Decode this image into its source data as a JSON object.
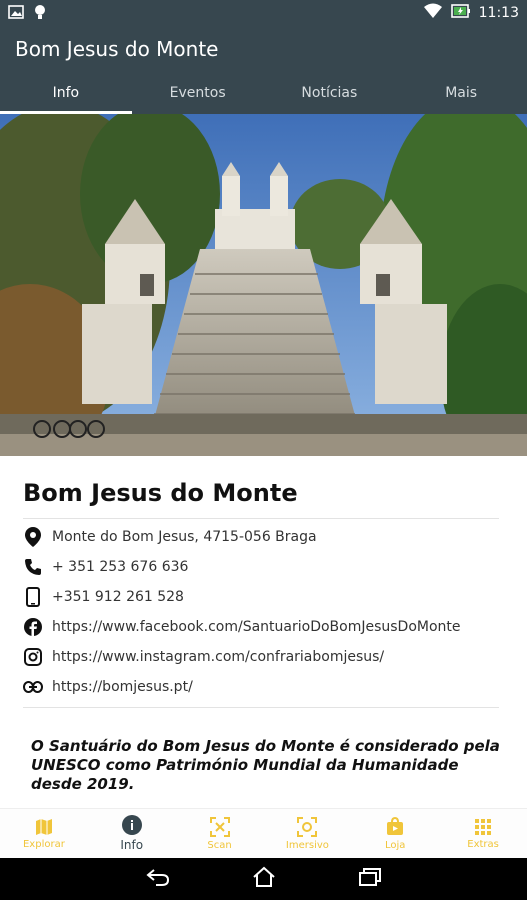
{
  "status_bar": {
    "time": "11:13",
    "icons": [
      "image-icon",
      "bulb-icon",
      "wifi-icon",
      "battery-charging-icon"
    ]
  },
  "app_bar": {
    "title": "Bom Jesus do Monte"
  },
  "tabs": [
    {
      "label": "Info",
      "active": true
    },
    {
      "label": "Eventos",
      "active": false
    },
    {
      "label": "Notícias",
      "active": false
    },
    {
      "label": "Mais",
      "active": false
    }
  ],
  "hero_image": {
    "subject": "sanctuary-church-stairs",
    "icon": "photo"
  },
  "place": {
    "title": "Bom Jesus do Monte",
    "address": "Monte do Bom Jesus, 4715-056 Braga",
    "phone": "+ 351 253 676 636",
    "mobile": "+351 912 261 528",
    "facebook": "https://www.facebook.com/SantuarioDoBomJesusDoMonte",
    "instagram": "https://www.instagram.com/confrariabomjesus/",
    "website": "https://bomjesus.pt/",
    "description": "O Santuário do Bom Jesus do Monte é considerado pela UNESCO como Património Mundial da Humanidade desde 2019."
  },
  "bottom_nav": [
    {
      "label": "Explorar",
      "icon": "map-icon",
      "active": false
    },
    {
      "label": "Info",
      "icon": "info-icon",
      "active": true
    },
    {
      "label": "Scan",
      "icon": "scan-icon",
      "active": false
    },
    {
      "label": "Imersivo",
      "icon": "immersive-icon",
      "active": false
    },
    {
      "label": "Loja",
      "icon": "shop-icon",
      "active": false
    },
    {
      "label": "Extras",
      "icon": "grid-icon",
      "active": false
    }
  ],
  "colors": {
    "app_bar": "#37474f",
    "accent": "#f0c53a",
    "text": "#111111"
  }
}
